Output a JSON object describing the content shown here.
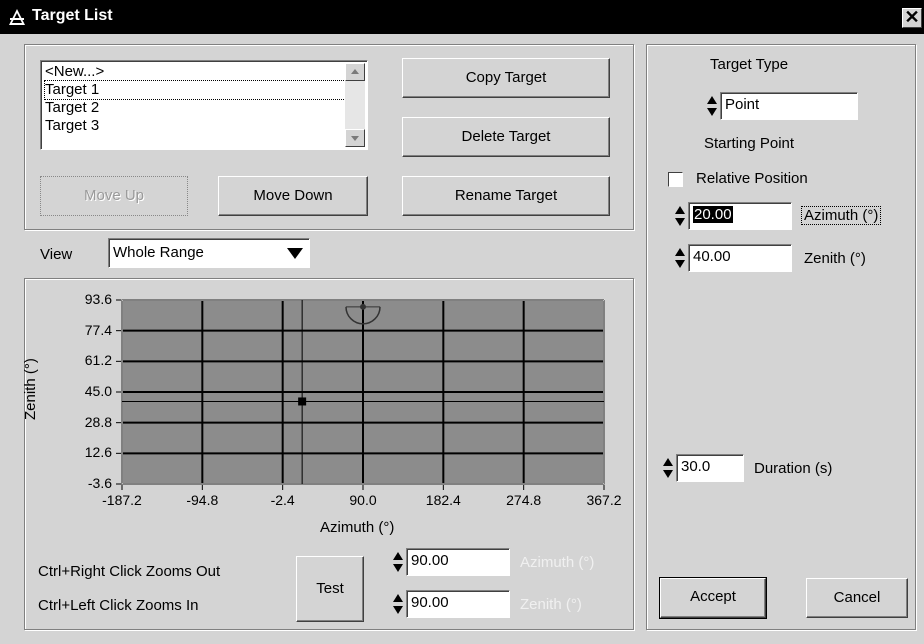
{
  "window": {
    "title": "Target List",
    "close_glyph": "✕"
  },
  "targets": {
    "items": [
      "<New...>",
      "Target 1",
      "Target 2",
      "Target 3"
    ],
    "selected_index": 1
  },
  "buttons": {
    "copy": "Copy Target",
    "delete": "Delete Target",
    "rename": "Rename Target",
    "move_up": "Move Up",
    "move_down": "Move Down",
    "test": "Test",
    "accept": "Accept",
    "cancel": "Cancel"
  },
  "view": {
    "label": "View",
    "value": "Whole Range"
  },
  "plot": {
    "xlabel": "Azimuth (°)",
    "ylabel": "Zenith (°)",
    "x_ticks": [
      "-187.2",
      "-94.8",
      "-2.4",
      "90.0",
      "182.4",
      "274.8",
      "367.2"
    ],
    "y_ticks": [
      "93.6",
      "77.4",
      "61.2",
      "45.0",
      "28.8",
      "12.6",
      "-3.6"
    ],
    "xlim": [
      -187.2,
      367.2
    ],
    "ylim": [
      -3.6,
      93.6
    ],
    "cursor": {
      "azimuth": 20.0,
      "zenith": 40.0
    },
    "target_marker": {
      "azimuth": 90.0,
      "zenith": 90.0
    },
    "background_color": "#8c8c8c"
  },
  "zoom_hints": {
    "out": "Ctrl+Right Click Zooms Out",
    "in": "Ctrl+Left Click Zooms In"
  },
  "test_fields": {
    "azimuth_value": "90.00",
    "azimuth_label": "Azimuth (°)",
    "zenith_value": "90.00",
    "zenith_label": "Zenith (°)"
  },
  "right_panel": {
    "target_type_label": "Target Type",
    "target_type_value": "Point",
    "starting_point_label": "Starting Point",
    "relative_position_label": "Relative Position",
    "relative_position_checked": false,
    "azimuth_value": "20.00",
    "azimuth_label": "Azimuth (°)",
    "zenith_value": "40.00",
    "zenith_label": "Zenith (°)",
    "duration_value": "30.0",
    "duration_label": "Duration (s)"
  }
}
